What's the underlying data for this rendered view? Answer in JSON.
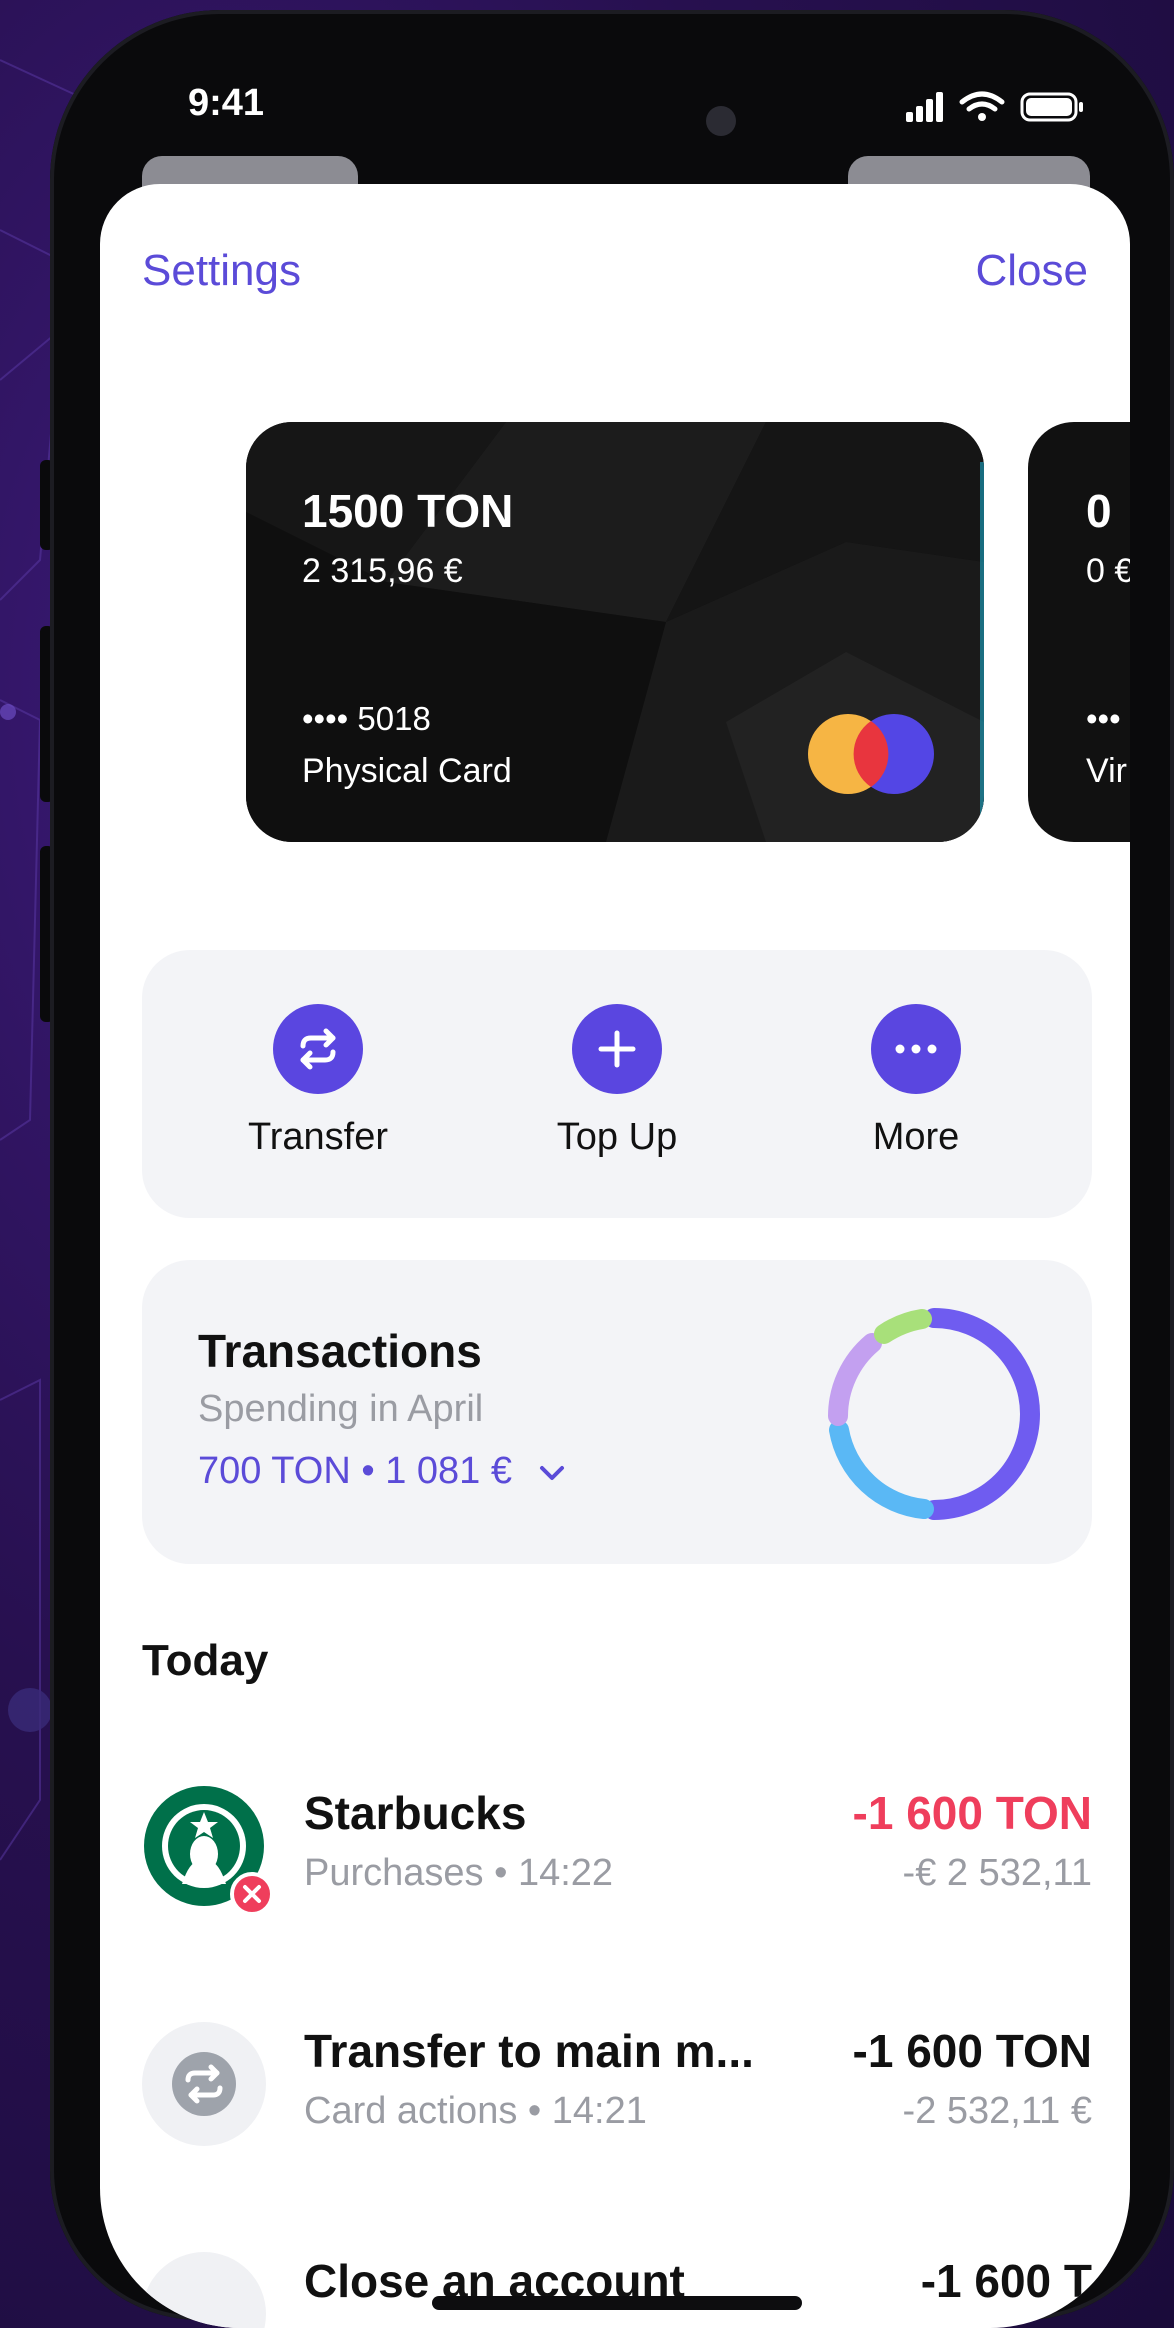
{
  "status_bar": {
    "time": "9:41",
    "icons": [
      "signal-icon",
      "wifi-icon",
      "battery-icon"
    ]
  },
  "nav": {
    "settings_label": "Settings",
    "close_label": "Close"
  },
  "cards": [
    {
      "amount": "1500 TON",
      "fiat": "2 315,96 €",
      "number": "•••• 5018",
      "type": "Physical Card",
      "brand": "mastercard"
    },
    {
      "amount": "0 ",
      "fiat": "0 €",
      "number": "•••",
      "type": "Vir"
    }
  ],
  "actions": [
    {
      "label": "Transfer",
      "icon": "transfer-icon"
    },
    {
      "label": "Top Up",
      "icon": "plus-icon"
    },
    {
      "label": "More",
      "icon": "more-icon"
    }
  ],
  "transactions_summary": {
    "title": "Transactions",
    "subtitle": "Spending in April",
    "total": "700 TON • 1 081 €",
    "chart_colors": [
      "#6f5cf0",
      "#5ab8f5",
      "#c3a0f0",
      "#a8e07a"
    ]
  },
  "section_today": "Today",
  "transactions": [
    {
      "name": "Starbucks",
      "meta": "Purchases • 14:22",
      "amount": "-1 600 TON",
      "amount_secondary": "-€ 2 532,11",
      "amount_color": "#ef3e5c",
      "icon": "starbucks-logo-icon",
      "badge": "error-badge-icon"
    },
    {
      "name": "Transfer to main m...",
      "meta": "Card actions • 14:21",
      "amount": "-1 600 TON",
      "amount_secondary": "-2 532,11 €",
      "amount_color": "#111111",
      "icon": "transfer-icon"
    },
    {
      "name": "Close an account",
      "meta": "",
      "amount": "-1 600 T",
      "amount_secondary": "",
      "amount_color": "#111111",
      "icon": "close-account-icon"
    }
  ],
  "colors": {
    "accent": "#5b4bd8",
    "negative": "#ef3e5c",
    "card_bg": "#111111"
  }
}
